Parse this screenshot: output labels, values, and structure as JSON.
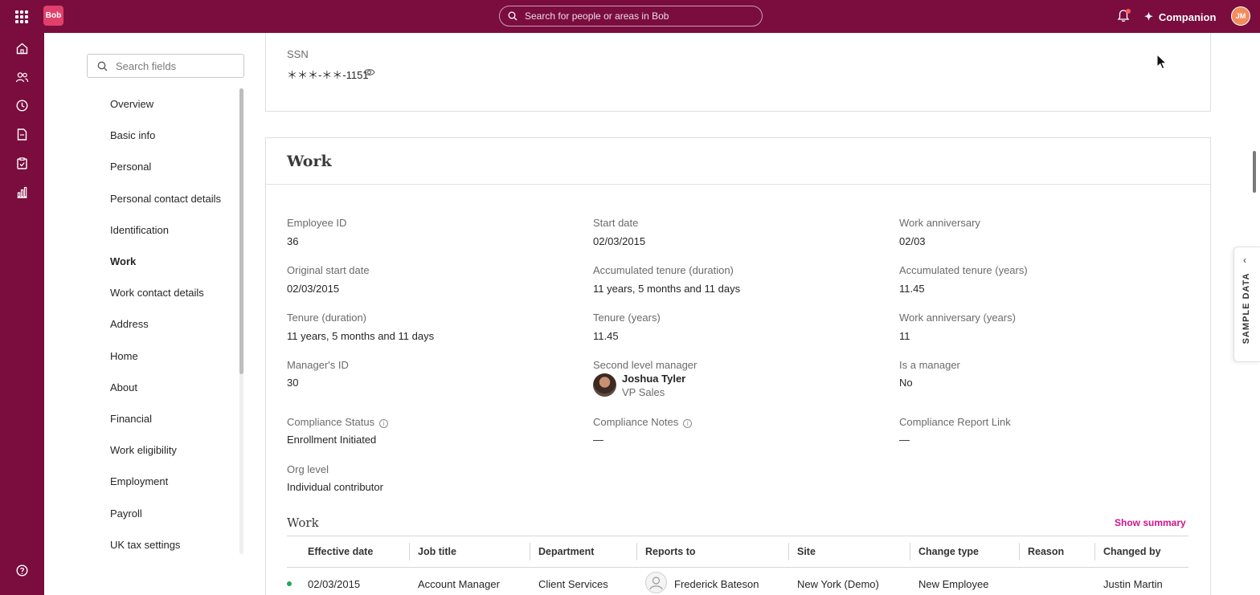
{
  "topbar": {
    "logo_text": "Bob",
    "search_placeholder": "Search for people or areas in Bob",
    "companion_label": "Companion",
    "user_initials": "JM"
  },
  "rail": {
    "items": [
      "home-icon",
      "people-icon",
      "clock-icon",
      "document-icon",
      "clipboard-icon",
      "analytics-icon",
      "help-icon"
    ]
  },
  "fields_nav": {
    "search_placeholder": "Search fields",
    "items": [
      {
        "label": "Overview"
      },
      {
        "label": "Basic info"
      },
      {
        "label": "Personal"
      },
      {
        "label": "Personal contact details"
      },
      {
        "label": "Identification"
      },
      {
        "label": "Work"
      },
      {
        "label": "Work contact details"
      },
      {
        "label": "Address"
      },
      {
        "label": "Home"
      },
      {
        "label": "About"
      },
      {
        "label": "Financial"
      },
      {
        "label": "Work eligibility"
      },
      {
        "label": "Employment"
      },
      {
        "label": "Payroll"
      },
      {
        "label": "UK tax settings"
      }
    ],
    "active": "Work"
  },
  "identification": {
    "ssn_label": "SSN",
    "ssn_value": "＊＊＊-＊＊-1151"
  },
  "work": {
    "title": "Work",
    "fields": {
      "employee_id_label": "Employee ID",
      "employee_id": "36",
      "start_date_label": "Start date",
      "start_date": "02/03/2015",
      "work_anniversary_label": "Work anniversary",
      "work_anniversary": "02/03",
      "original_start_date_label": "Original start date",
      "original_start_date": "02/03/2015",
      "acc_tenure_duration_label": "Accumulated tenure (duration)",
      "acc_tenure_duration": "11 years, 5 months and 11 days",
      "acc_tenure_years_label": "Accumulated tenure (years)",
      "acc_tenure_years": "11.45",
      "tenure_duration_label": "Tenure (duration)",
      "tenure_duration": "11 years, 5 months and 11 days",
      "tenure_years_label": "Tenure (years)",
      "tenure_years": "11.45",
      "work_anniversary_years_label": "Work anniversary (years)",
      "work_anniversary_years": "11",
      "manager_id_label": "Manager's ID",
      "manager_id": "30",
      "second_level_manager_label": "Second level manager",
      "second_level_manager_name": "Joshua Tyler",
      "second_level_manager_title": "VP Sales",
      "is_manager_label": "Is a manager",
      "is_manager": "No",
      "compliance_status_label": "Compliance Status",
      "compliance_status": "Enrollment Initiated",
      "compliance_notes_label": "Compliance Notes",
      "compliance_notes": "—",
      "compliance_report_link_label": "Compliance Report Link",
      "compliance_report_link": "—",
      "org_level_label": "Org level",
      "org_level": "Individual contributor"
    },
    "history": {
      "title": "Work",
      "show_summary": "Show summary",
      "columns": [
        "Effective date",
        "Job title",
        "Department",
        "Reports to",
        "Site",
        "Change type",
        "Reason",
        "Changed by"
      ],
      "rows": [
        {
          "effective_date": "02/03/2015",
          "job_title": "Account Manager",
          "department": "Client Services",
          "reports_to": "Frederick Bateson",
          "site": "New York (Demo)",
          "change_type": "New Employee",
          "reason": "",
          "changed_by": "Justin Martin",
          "status_color": "#1fa85a"
        }
      ]
    }
  },
  "side_panel": {
    "label": "SAMPLE DATA"
  },
  "colors": {
    "brand": "#7a0d3e",
    "accent": "#d1148b"
  }
}
